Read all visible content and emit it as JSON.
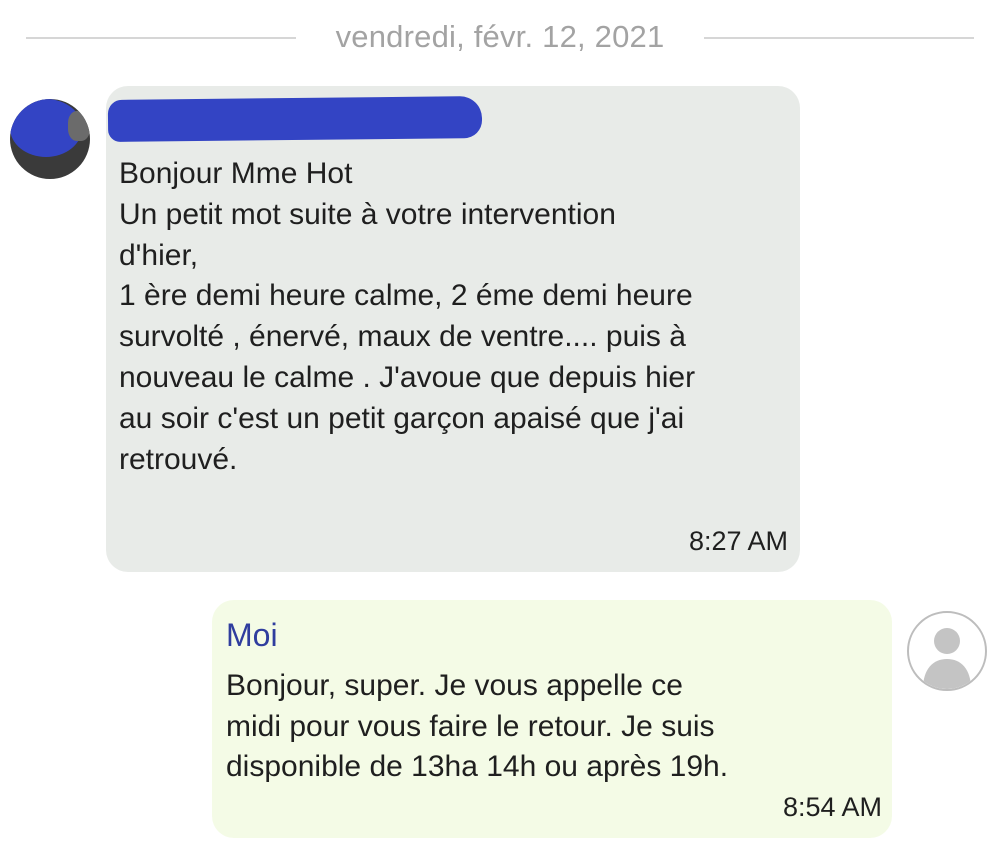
{
  "date_separator": "vendredi, févr. 12, 2021",
  "incoming": {
    "message": "Bonjour Mme Hot\nUn petit mot suite à votre intervention\nd'hier,\n1 ère demi heure calme, 2 éme demi heure\nsurvolté , énervé, maux de ventre.... puis à\nnouveau le calme . J'avoue que depuis hier\nau soir c'est un petit garçon apaisé que j'ai\nretrouvé.",
    "time": "8:27 AM"
  },
  "outgoing": {
    "sender": "Moi",
    "message": "Bonjour, super.  Je vous appelle ce\nmidi pour vous faire le retour. Je suis\ndisponible de 13ha 14h ou après 19h.",
    "time": "8:54 AM"
  },
  "icons": {
    "incoming_avatar": "contact-photo-redacted",
    "outgoing_avatar": "default-person-icon"
  },
  "colors": {
    "incoming_bubble": "#e8ebe8",
    "outgoing_bubble": "#f4fbe6",
    "self_name": "#2f3d9e",
    "redaction": "#3344c4",
    "date_text": "#a3a3a3"
  }
}
